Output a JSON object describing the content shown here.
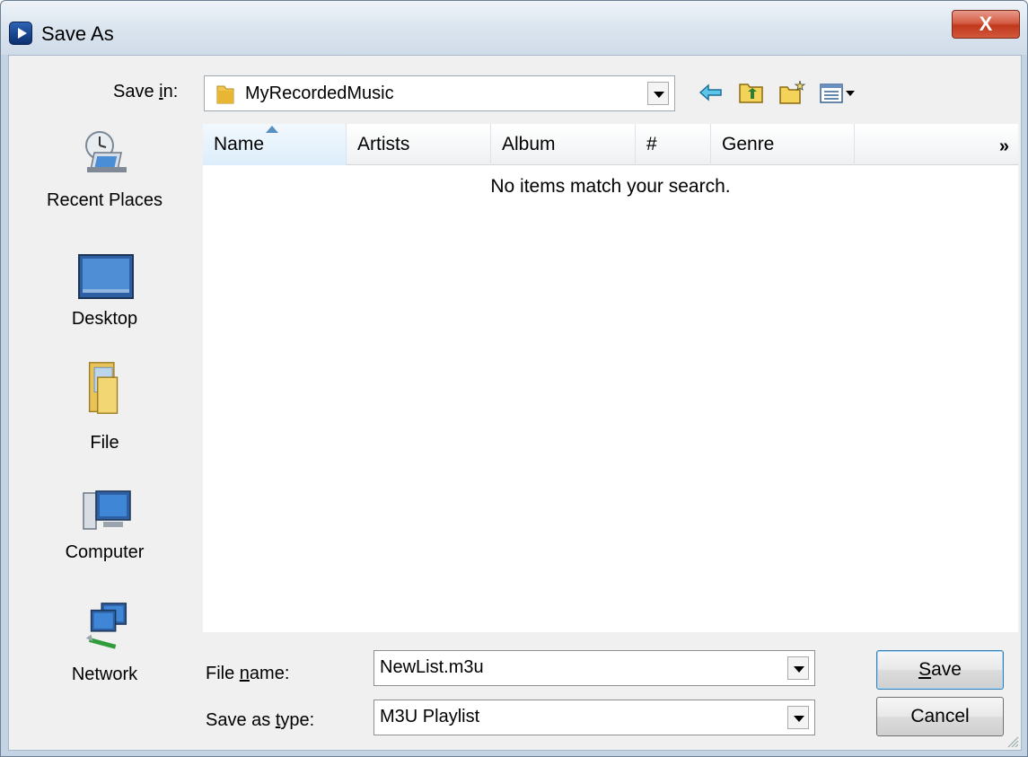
{
  "window": {
    "title": "Save As",
    "close_label": "X"
  },
  "save_in": {
    "label_pre": "Save ",
    "label_accel": "i",
    "label_post": "n:",
    "value": "MyRecordedMusic"
  },
  "toolbar": {
    "icons": [
      "back-arrow-icon",
      "up-folder-icon",
      "new-folder-icon",
      "view-menu-icon"
    ]
  },
  "places": [
    {
      "label": "Recent Places",
      "icon": "recent-places-icon"
    },
    {
      "label": "Desktop",
      "icon": "desktop-icon"
    },
    {
      "label": "File",
      "icon": "file-folder-icon"
    },
    {
      "label": "Computer",
      "icon": "computer-icon"
    },
    {
      "label": "Network",
      "icon": "network-icon"
    }
  ],
  "columns": [
    "Name",
    "Artists",
    "Album",
    "#",
    "Genre"
  ],
  "more_columns": "»",
  "empty_message": "No items match your search.",
  "file_name": {
    "label_pre": "File ",
    "label_accel": "n",
    "label_post": "ame:",
    "value": "NewList.m3u"
  },
  "save_as_type": {
    "label_pre": "Save as ",
    "label_accel": "t",
    "label_post": "ype:",
    "value": "M3U Playlist"
  },
  "buttons": {
    "save_accel": "S",
    "save_rest": "ave",
    "cancel": "Cancel"
  },
  "colors": {
    "titlebar": "#dbe5ef",
    "close": "#c0381c",
    "client": "#f0f0f0"
  }
}
